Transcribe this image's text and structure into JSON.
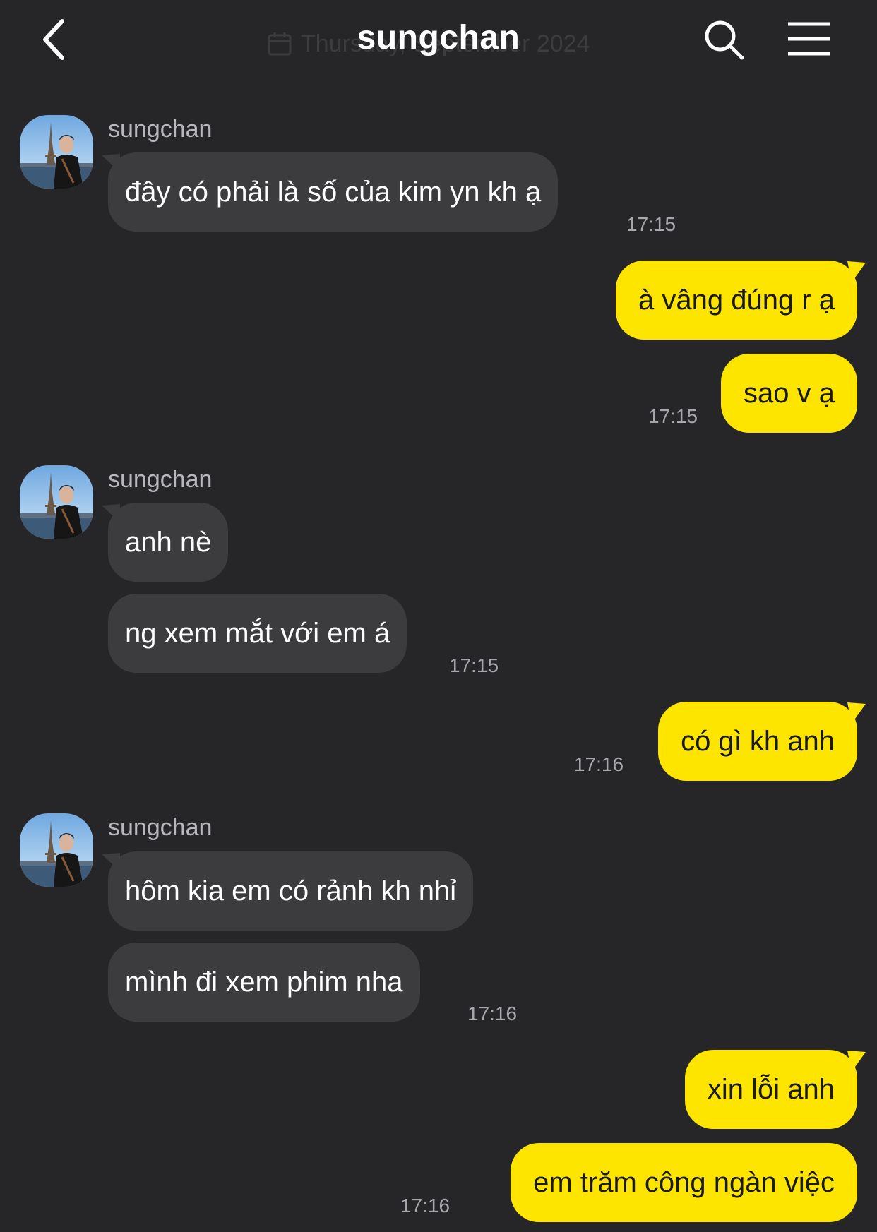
{
  "header": {
    "title": "sungchan",
    "date_overlay": "Thursday, September 2024"
  },
  "icons": {
    "back": "chevron-left-icon",
    "search": "search-icon",
    "menu": "hamburger-menu-icon",
    "calendar": "calendar-icon"
  },
  "colors": {
    "background": "#262628",
    "incoming_bubble": "#3c3c3e",
    "outgoing_bubble": "#fee500",
    "timestamp": "#a8a8ac"
  },
  "messages": [
    {
      "direction": "in",
      "sender": "sungchan",
      "text": "đây có phải là số của kim yn kh ạ",
      "time": "17:15"
    },
    {
      "direction": "out",
      "text": "à vâng đúng r ạ"
    },
    {
      "direction": "out",
      "text": "sao v ạ",
      "time": "17:15"
    },
    {
      "direction": "in",
      "sender": "sungchan",
      "text": "anh nè"
    },
    {
      "direction": "in",
      "text": "ng xem mắt với em á",
      "time": "17:15"
    },
    {
      "direction": "out",
      "text": "có gì kh anh",
      "time": "17:16"
    },
    {
      "direction": "in",
      "sender": "sungchan",
      "text": "hôm kia em có rảnh kh nhỉ"
    },
    {
      "direction": "in",
      "text": "mình đi xem phim nha",
      "time": "17:16"
    },
    {
      "direction": "out",
      "text": "xin lỗi anh"
    },
    {
      "direction": "out",
      "text": "em trăm công ngàn việc",
      "time": "17:16"
    }
  ]
}
